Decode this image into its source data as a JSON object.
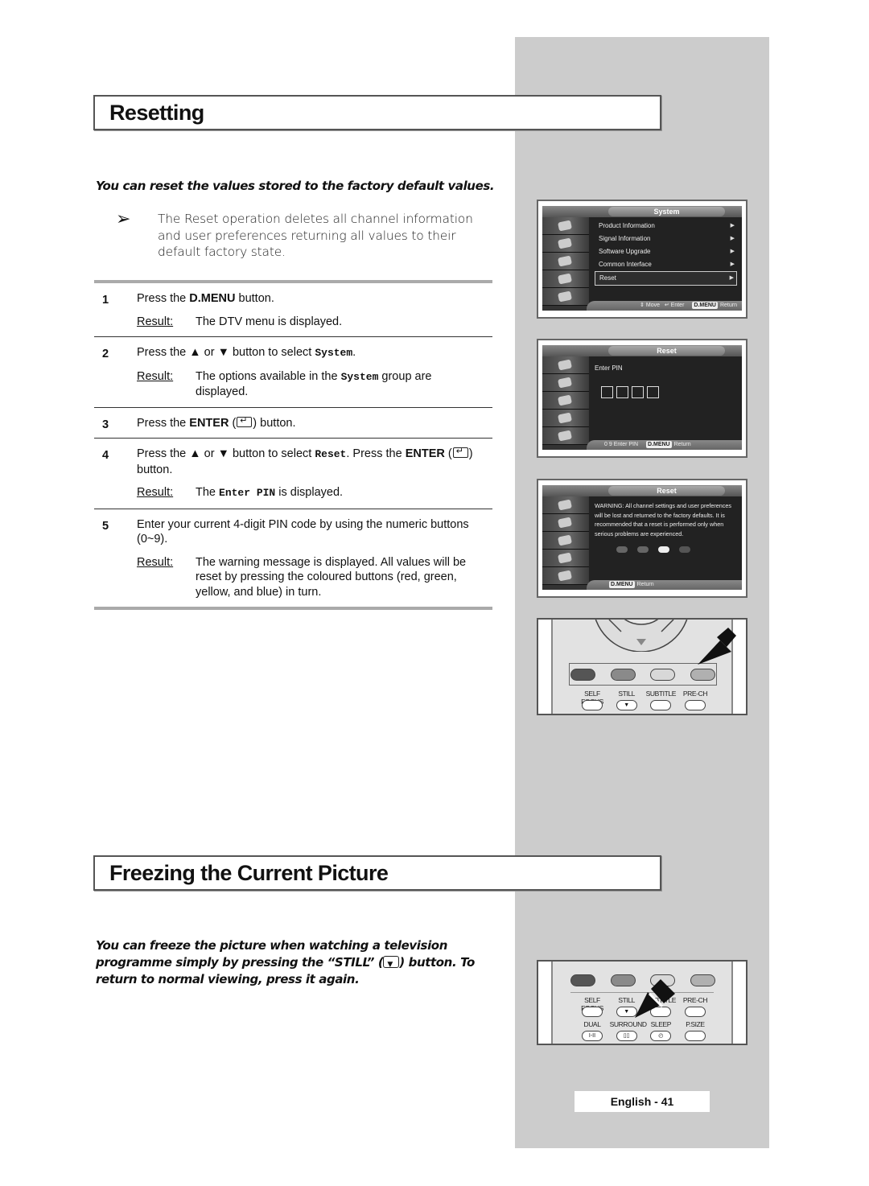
{
  "resetting": {
    "title": "Resetting",
    "intro": "You can reset the values stored to the factory default values.",
    "note_icon": "arrow-note-icon",
    "note": "The Reset operation deletes all channel information and user preferences returning all values to their default factory state.",
    "result_label": "Result:",
    "steps": [
      {
        "num": "1",
        "instr_pre": "Press the ",
        "instr_bold": "D.MENU",
        "instr_post": " button.",
        "result": "The DTV menu is displayed."
      },
      {
        "num": "2",
        "instr_pre": "Press the ▲ or ▼ button to select ",
        "instr_mono": "System",
        "instr_post": ".",
        "result_pre": "The options available in the ",
        "result_mono": "System",
        "result_post": " group are displayed."
      },
      {
        "num": "3",
        "instr_pre": "Press the ",
        "instr_bold": "ENTER",
        "instr_post": " button."
      },
      {
        "num": "4",
        "instr_pre": "Press the ▲ or ▼ button to select ",
        "instr_mono": "Reset",
        "instr_mid": ". Press the ",
        "instr_bold": "ENTER",
        "instr_post": " button.",
        "result_pre": "The ",
        "result_mono": "Enter PIN",
        "result_post": " is displayed."
      },
      {
        "num": "5",
        "instr": "Enter your current 4-digit PIN code by using the numeric buttons (0~9).",
        "result": "The warning message is displayed. All values will be reset by pressing the coloured buttons (red, green, yellow, and blue) in turn."
      }
    ]
  },
  "tv_screens": {
    "system_menu": {
      "title": "System",
      "items": [
        "Product Information",
        "Signal Information",
        "Software Upgrade",
        "Common Interface",
        "Reset"
      ],
      "selected": "Reset",
      "hint_move": "Move",
      "hint_enter": "Enter",
      "hint_dmenu": "D.MENU",
      "hint_return": "Return"
    },
    "enter_pin": {
      "title": "Reset",
      "label": "Enter PIN",
      "hint_digits": "0 9",
      "hint_enter": "Enter PIN",
      "hint_dmenu": "D.MENU",
      "hint_return": "Return"
    },
    "warning": {
      "title": "Reset",
      "message": "WARNING: All channel settings and user preferences will be lost and returned to the factory defaults. It is recommended that a reset is performed only when serious problems are experienced.",
      "button_colors": [
        "#666666",
        "#666666",
        "#eeeeee",
        "#555555"
      ],
      "hint_dmenu": "D.MENU",
      "hint_return": "Return"
    }
  },
  "remote1": {
    "color_buttons": [
      "#555555",
      "#8a8a8a",
      "#d8d8d8",
      "#b0b0b0"
    ],
    "labels": [
      "SELF FOCUS",
      "STILL",
      "SUBTITLE",
      "PRE-CH"
    ]
  },
  "remote2": {
    "color_buttons": [
      "#555555",
      "#8a8a8a",
      "#d8d8d8",
      "#b0b0b0"
    ],
    "labels_row1": [
      "SELF FOCUS",
      "STILL",
      "SUBTITLE",
      "PRE-CH"
    ],
    "labels_row2": [
      "DUAL",
      "SURROUND",
      "SLEEP",
      "P.SIZE"
    ],
    "btn_glyphs_row2": [
      "I-II",
      "▯▯",
      "◴",
      ""
    ]
  },
  "freezing": {
    "title": "Freezing the Current Picture",
    "intro_pre": "You can freeze the picture when watching a television programme simply by pressing the “STILL” (",
    "intro_post": ") button. To return to normal viewing, press it again."
  },
  "footer": {
    "page_label": "English - 41"
  }
}
